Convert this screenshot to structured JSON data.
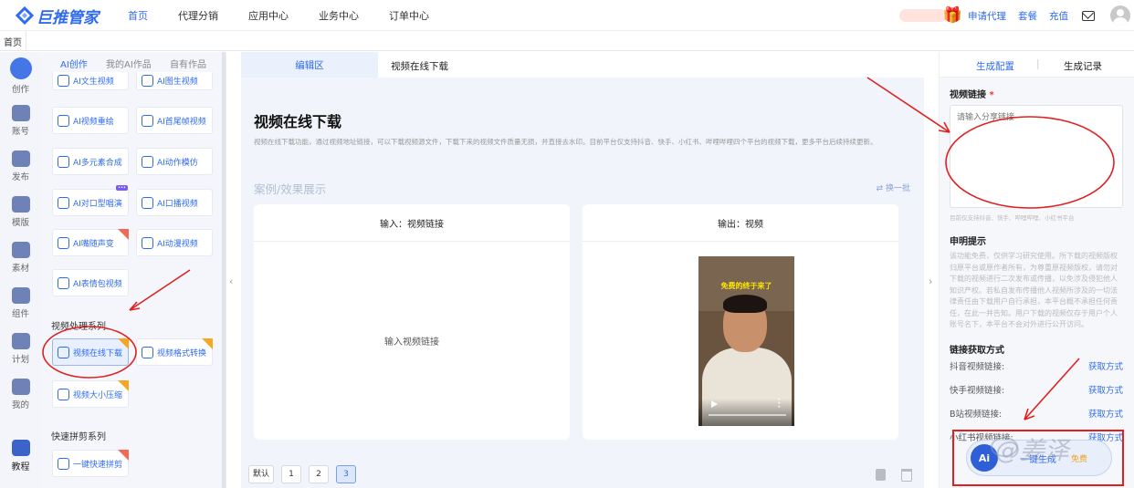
{
  "brand": {
    "logo_text": "巨推管家",
    "accent": "#2f6bf0"
  },
  "topnav": {
    "items": [
      "首页",
      "代理分销",
      "应用中心",
      "业务中心",
      "订单中心"
    ],
    "active": 0
  },
  "topright": {
    "apply_agent": "申请代理",
    "package": "套餐",
    "recharge": "充值"
  },
  "tabs": {
    "home": "首页"
  },
  "rail": {
    "items": [
      "创作",
      "账号",
      "发布",
      "模版",
      "素材",
      "组件",
      "计划",
      "我的"
    ],
    "bottom": "教程"
  },
  "panel": {
    "tabs": [
      "AI创作",
      "我的AI作品",
      "自有作品"
    ],
    "cards_top": [
      "AI文生视频",
      "AI图生视频",
      "AI视频重绘",
      "AI首尾帧视频",
      "AI多元素合成",
      "AI动作模仿",
      "AI对口型唱演",
      "AI口播视频",
      "AI嘴随声变",
      "AI动漫视频",
      "AI表情包视频"
    ],
    "section_video": "视频处理系列",
    "cards_video": [
      "视频在线下载",
      "视频格式转换",
      "视频大小压缩"
    ],
    "section_quick": "快速拼剪系列",
    "cards_quick": [
      "一键快速拼剪"
    ]
  },
  "editor": {
    "tab_edit": "编辑区",
    "tab_name": "视频在线下载",
    "title": "视频在线下载",
    "description": "视频在线下载功能，通过视频地址链接，可以下载视频源文件，下载下来的视频文件质量无损，并直接去水印。目前平台仅支持抖音、快手、小红书、哔哩哔哩四个平台的视频下载，更多平台后续持续更新。",
    "showcase": "案例/效果展示",
    "swap": "换一批",
    "input_header": "输入：视频链接",
    "input_body": "输入视频链接",
    "output_header": "输出：视频",
    "video_caption": "免费的终于来了",
    "pager": [
      "默认",
      "1",
      "2",
      "3"
    ],
    "pager_current": 3
  },
  "side": {
    "tab_config": "生成配置",
    "tab_record": "生成记录",
    "link_label": "视频链接",
    "required_mark": "*",
    "link_placeholder": "请输入分享链接",
    "link_hint": "目前仅支持抖音、快手、哔哩哔哩、小红书平台",
    "notice_label": "申明提示",
    "notice_text": "该功能免费，仅供学习研究使用。所下载的视频版权归原平台或原作者所有，为尊重原视频版权，请勿对下载的视频进行二次发布或传播，以免涉及侵犯他人知识产权。若私自发布传播他人视频所涉及的一切法律责任由下载用户自行承担，本平台概不承担任何责任，在此一并告知。用户下载的视频仅存于用户个人账号名下，本平台不会对外进行公开访问。",
    "method_label": "链接获取方式",
    "methods": [
      {
        "label": "抖音视频链接:",
        "link": "获取方式"
      },
      {
        "label": "快手视频链接:",
        "link": "获取方式"
      },
      {
        "label": "B站视频链接:",
        "link": "获取方式"
      },
      {
        "label": "小红书视频链接:",
        "link": "获取方式"
      }
    ],
    "gen_ai": "Ai",
    "gen_label": "一键生成",
    "gen_cost": "免费"
  },
  "watermark": "@姜泽"
}
